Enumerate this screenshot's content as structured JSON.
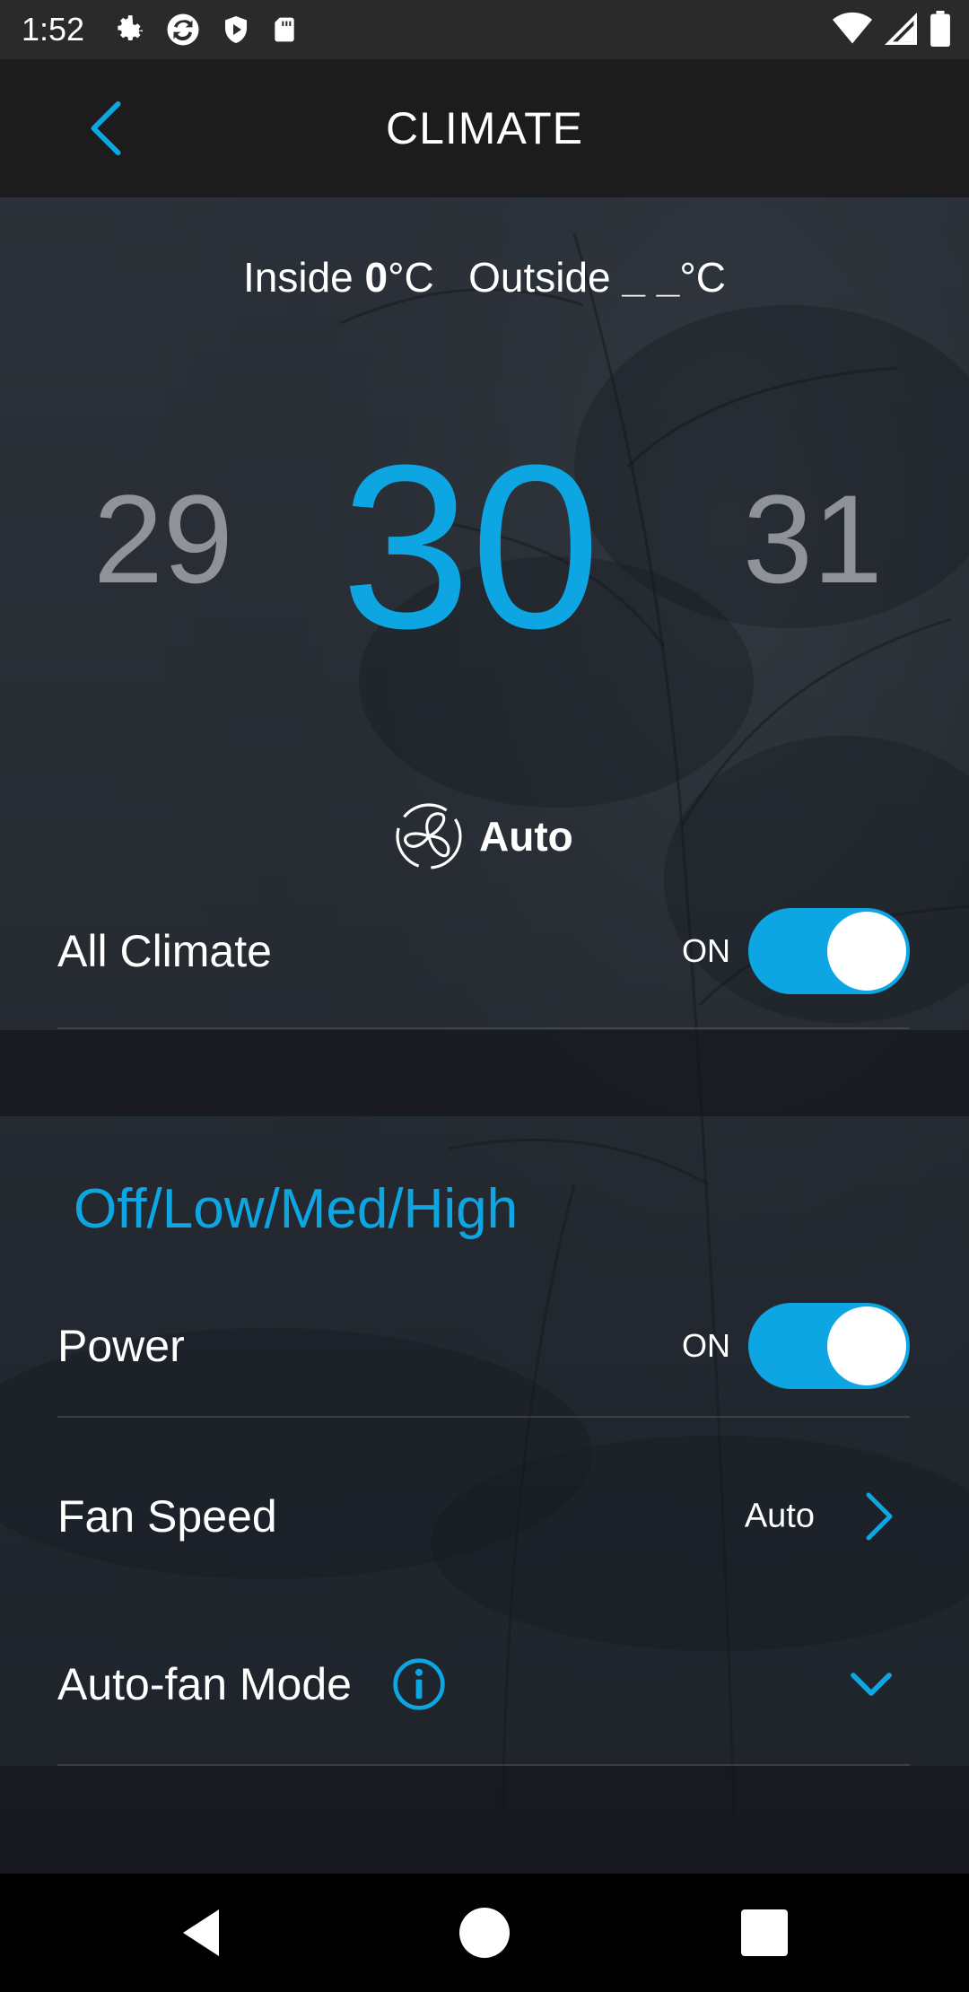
{
  "status_bar": {
    "time": "1:52",
    "left_icons": [
      "settings-icon",
      "sync-icon",
      "shield-icon",
      "sd-card-icon"
    ],
    "right_icons": [
      "wifi-icon",
      "signal-icon",
      "battery-icon"
    ]
  },
  "header": {
    "title": "CLIMATE",
    "back_icon": "chevron-left-icon"
  },
  "temperature": {
    "inside_label": "Inside",
    "inside_value": "0",
    "inside_unit": "°C",
    "outside_label": "Outside",
    "outside_value": "_ _",
    "outside_unit": "°C",
    "previous": "29",
    "current": "30",
    "next": "31"
  },
  "fan_mode": {
    "icon": "fan-icon",
    "label": "Auto"
  },
  "all_climate": {
    "label": "All Climate",
    "state": "ON",
    "on": true
  },
  "section": {
    "title": "Off/Low/Med/High"
  },
  "power": {
    "label": "Power",
    "state": "ON",
    "on": true
  },
  "fan_speed": {
    "label": "Fan Speed",
    "value": "Auto"
  },
  "auto_fan_mode": {
    "label": "Auto-fan Mode"
  },
  "colors": {
    "accent": "#0ea5e3",
    "text": "#ffffff",
    "muted_temp": "#8f9297"
  }
}
